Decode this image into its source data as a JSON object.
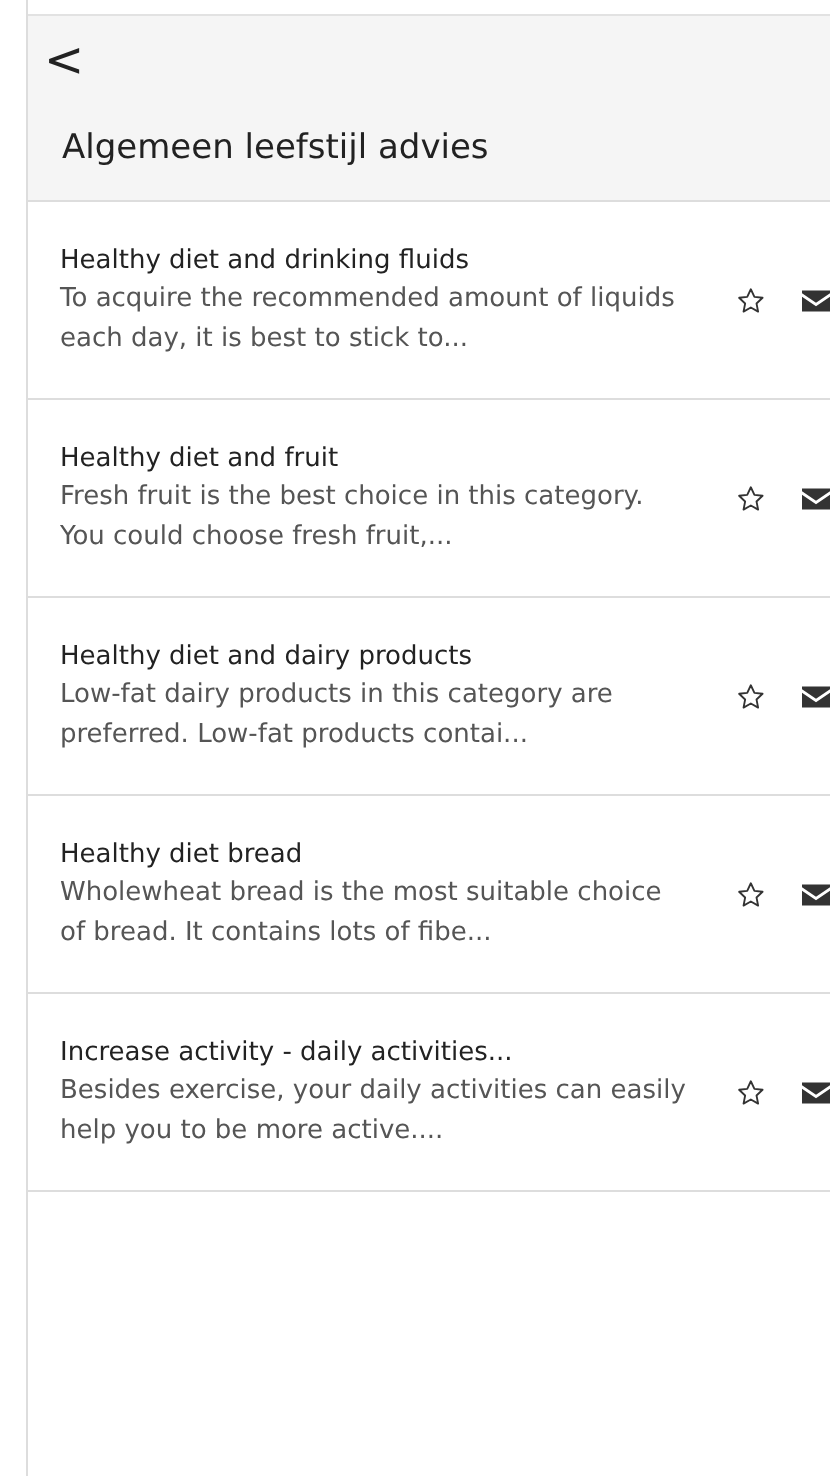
{
  "header": {
    "back": "<",
    "title": "Algemeen leefstijl advies"
  },
  "items": [
    {
      "title": "Healthy diet and drinking fluids",
      "snippet": "To acquire the recommended amount of liquids each day, it is best to stick to...",
      "favorite": false
    },
    {
      "title": "Healthy diet and fruit",
      "snippet": "Fresh fruit is the best choice in this category. You could choose fresh fruit,...",
      "favorite": false
    },
    {
      "title": "Healthy diet and dairy products",
      "snippet": "Low-fat dairy products in this category are preferred. Low-fat products contai...",
      "favorite": false
    },
    {
      "title": "Healthy diet bread",
      "snippet": "Wholewheat bread is the most suitable choice of bread. It contains lots of fibe...",
      "favorite": false
    },
    {
      "title": "Increase activity - daily activities...",
      "snippet": "Besides exercise, your daily activities can easily help you to be more active....",
      "favorite": false
    }
  ]
}
